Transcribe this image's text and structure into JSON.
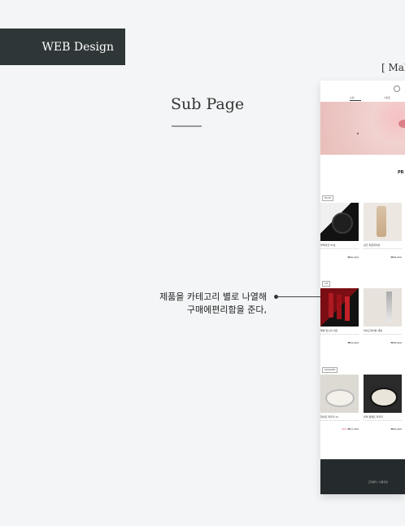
{
  "tag": {
    "label": "WEB Design"
  },
  "subpage": {
    "title": "Sub Page"
  },
  "make": {
    "label": "[ Mak"
  },
  "annotation": {
    "line1": "제품을 카테고리 별로 나열해",
    "line2": "구매에편리함을 준다,"
  },
  "mock": {
    "nav_tabs": [
      "쇼핑",
      "이벤트"
    ],
    "headline": "PR",
    "categories": [
      "BASE",
      "LIP",
      "POWDER"
    ],
    "cards": [
      {
        "name": "블랙쿠션 21호",
        "price": "₩40,000",
        "sale": ""
      },
      {
        "name": "실크 파운데이션",
        "price": "₩48,000",
        "sale": ""
      },
      {
        "name": "벨벳 립스틱 세트",
        "price": "₩52,000",
        "sale": ""
      },
      {
        "name": "하이드레이팅 세럼",
        "price": "₩38,000",
        "sale": ""
      },
      {
        "name": "화이트 파우더 21",
        "price": "₩27,300",
        "sale": "30%"
      },
      {
        "name": "블랙 컴팩트 파우더",
        "price": "₩44,000",
        "sale": ""
      }
    ],
    "footer_text": "고객센터 | 이용약관"
  }
}
